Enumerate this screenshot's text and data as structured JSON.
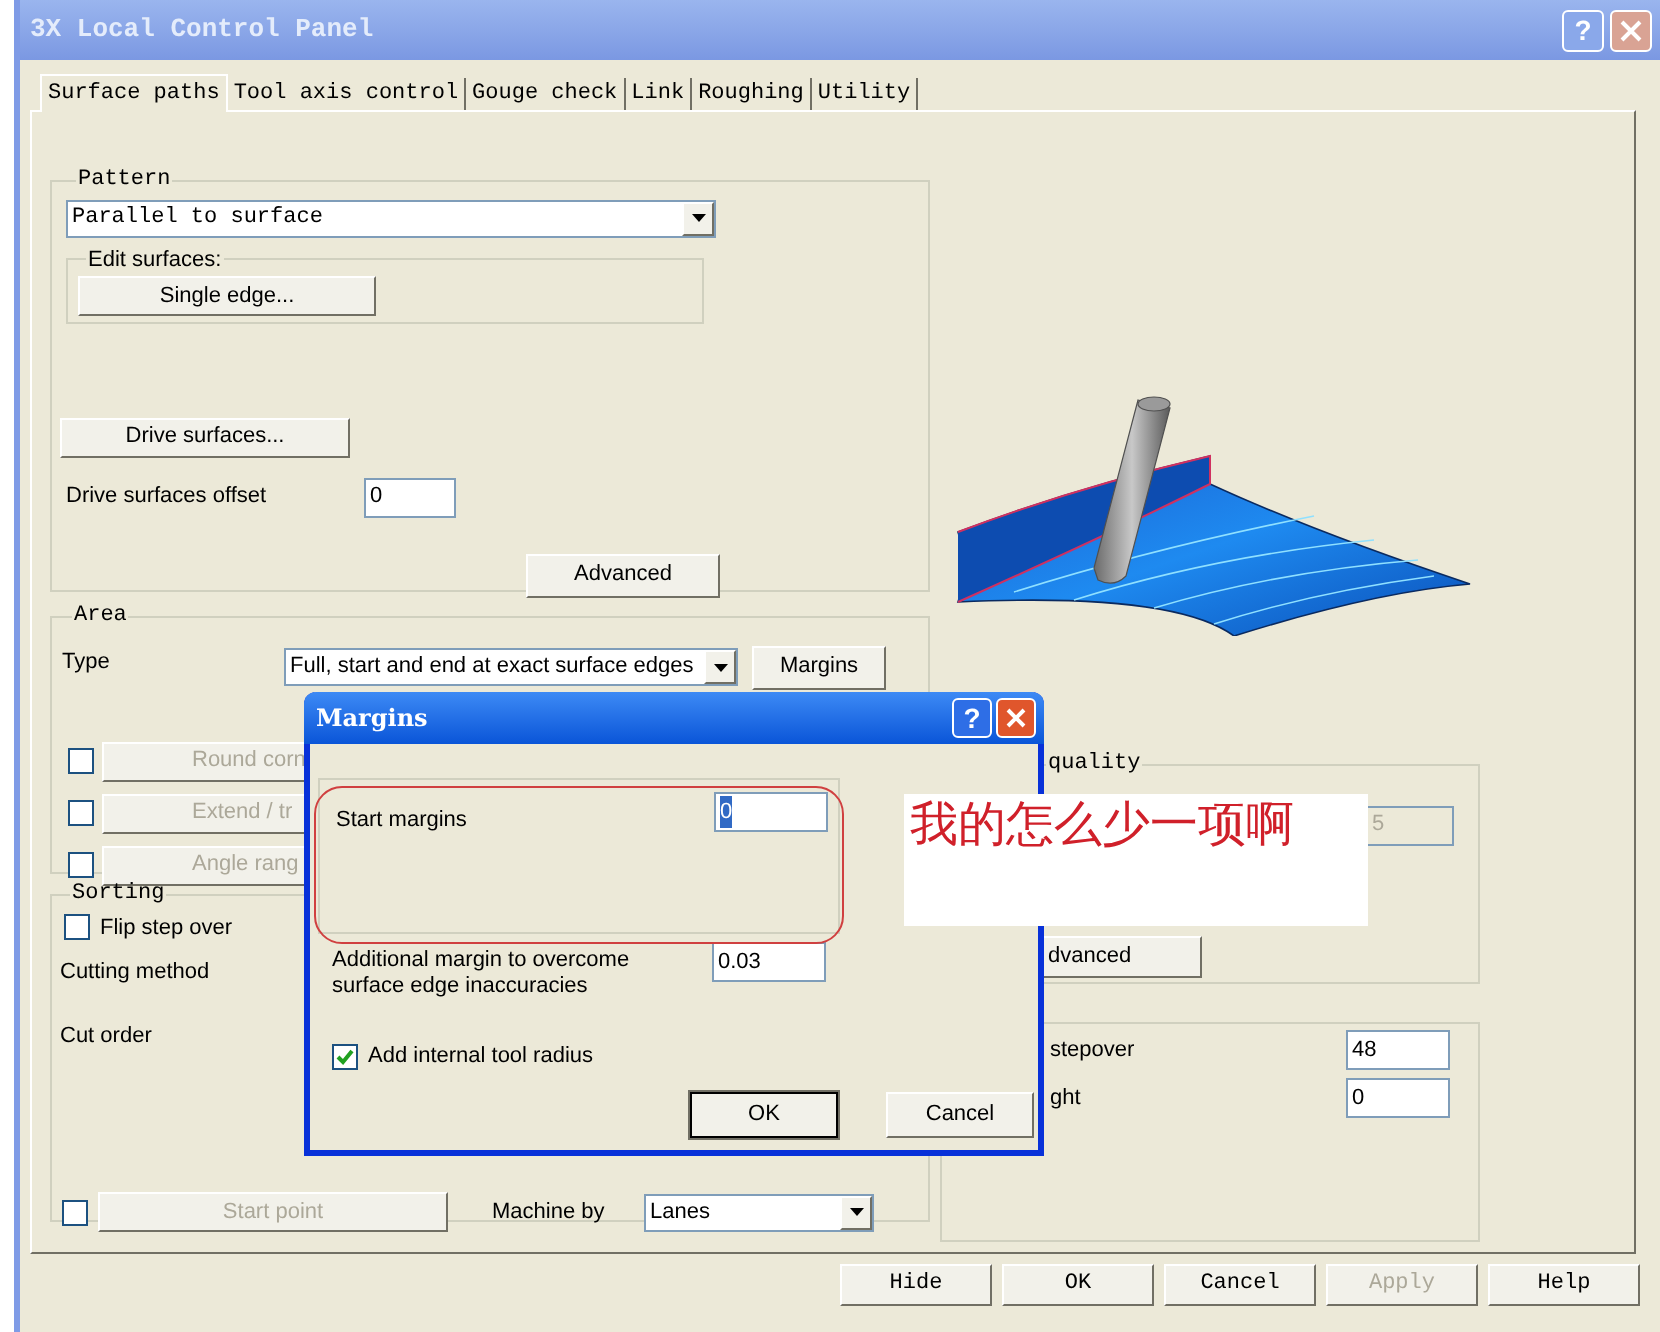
{
  "window": {
    "title": "3X Local Control Panel",
    "help_button": "?"
  },
  "tabs": [
    {
      "label": "Surface paths",
      "selected": true
    },
    {
      "label": "Tool axis control",
      "selected": false
    },
    {
      "label": "Gouge check",
      "selected": false
    },
    {
      "label": "Link",
      "selected": false
    },
    {
      "label": "Roughing",
      "selected": false
    },
    {
      "label": "Utility",
      "selected": false
    }
  ],
  "pattern": {
    "legend": "Pattern",
    "select": "Parallel to surface",
    "edit_surfaces": {
      "legend": "Edit surfaces:",
      "button": "Single edge..."
    },
    "drive_button": "Drive surfaces...",
    "offset": {
      "label": "Drive surfaces offset",
      "value": "0"
    },
    "advanced_button": "Advanced"
  },
  "area": {
    "legend": "Area",
    "type_label": "Type",
    "type_select": "Full, start and end at exact surface edges",
    "margins_button": "Margins",
    "options": [
      {
        "label": "Round corn",
        "checked": false,
        "disabled": true
      },
      {
        "label": "Extend / tr",
        "checked": false,
        "disabled": true
      },
      {
        "label": "Angle rang",
        "checked": false,
        "disabled": true
      }
    ]
  },
  "sorting": {
    "legend": "Sorting",
    "flip": {
      "label": "Flip step over",
      "checked": false
    },
    "cutting_method_label": "Cutting method",
    "cut_order_label": "Cut order",
    "start_point": {
      "label": "Start point",
      "checked": false,
      "disabled": true
    },
    "machine_by": {
      "label": "Machine by",
      "value": "Lanes"
    }
  },
  "right": {
    "quality": {
      "legend": "quality",
      "field": {
        "value": "5",
        "disabled": true
      },
      "button": "dvanced"
    },
    "rows": [
      {
        "label": "stepover",
        "value": "48"
      },
      {
        "label": "ght",
        "value": "0"
      }
    ]
  },
  "footer_buttons": [
    {
      "label": "Hide",
      "disabled": false
    },
    {
      "label": "OK",
      "disabled": false
    },
    {
      "label": "Cancel",
      "disabled": false
    },
    {
      "label": "Apply",
      "disabled": true
    },
    {
      "label": "Help",
      "disabled": false
    }
  ],
  "margins_dialog": {
    "title": "Margins",
    "help_button": "?",
    "start_margins": {
      "label": "Start margins",
      "value": "0"
    },
    "additional": {
      "label": "Additional margin to overcome surface edge inaccuracies",
      "value": "0.03"
    },
    "add_radius": {
      "label": "Add internal tool radius",
      "checked": true
    },
    "buttons": [
      {
        "label": "OK",
        "default": true
      },
      {
        "label": "Cancel",
        "default": false
      }
    ]
  },
  "annotation": {
    "text": "我的怎么少一项啊"
  }
}
